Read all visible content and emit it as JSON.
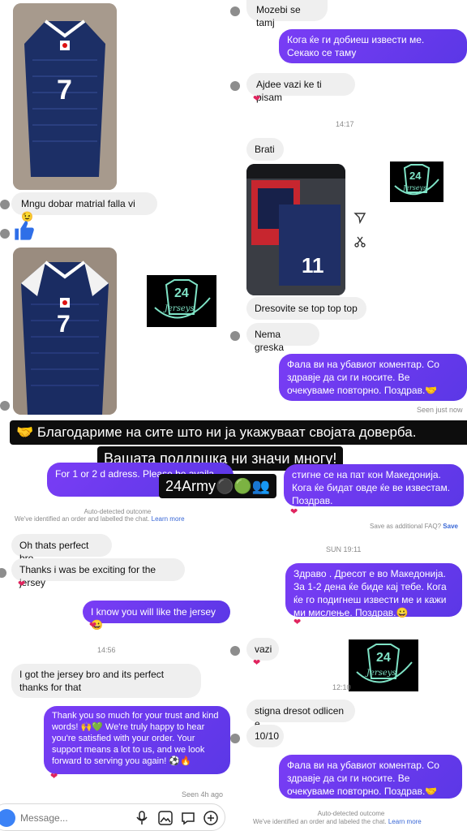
{
  "top_left": {
    "messages": [
      {
        "id": "m1",
        "text": "Mngu dobar matrial falla vi 😉"
      }
    ]
  },
  "top_right": {
    "messages": [
      {
        "id": "r1",
        "dir": "in",
        "text": "Mozebi se tamj"
      },
      {
        "id": "r2",
        "dir": "out",
        "text": "Кога ќе ги добиеш извести ме. Секако се таму"
      },
      {
        "id": "r3",
        "dir": "in",
        "text": "Ajdee vazi ke ti pisam"
      },
      {
        "id": "r4",
        "dir": "in",
        "text": "Brati"
      },
      {
        "id": "r5",
        "dir": "in",
        "text": "Dresovite se top top top"
      },
      {
        "id": "r6",
        "dir": "in",
        "text": "Nema greska"
      },
      {
        "id": "r7",
        "dir": "out",
        "text": "Фала ви на убавиот коментар. Со здравје да си ги носите. Ве очекуваме повторно. Поздрав.🤝"
      }
    ],
    "time": "14:17",
    "status": "Seen just now"
  },
  "banner": {
    "line1": "🤝 Благодариме на сите што ни ја укажуваат својата доверба.",
    "line2": "Вашата поддршка ни значи многу!",
    "line3": "24Army⚫🟢👥"
  },
  "bottom_left": {
    "partial_out": "For 1 or 2 d adress. Please be availa",
    "auto_detect_title": "Auto-detected outcome",
    "auto_detect_text": "We've identified an order and labelled the chat.",
    "learn_more": "Learn more",
    "messages": [
      {
        "id": "b1",
        "dir": "in",
        "text": "Oh thats perfect bro"
      },
      {
        "id": "b2",
        "dir": "in",
        "text": "Thanks i was be exciting for the jersey"
      },
      {
        "id": "b3",
        "dir": "out",
        "text": "I know you will like the jersey😀"
      },
      {
        "id": "b4",
        "dir": "in",
        "text": "I got the jersey bro and its perfect thanks for that"
      },
      {
        "id": "b5",
        "dir": "out",
        "text": "Thank you so much for your trust and kind words! 🙌💚 We're truly happy to hear you're satisfied with your order. Your support means a lot to us, and we look forward to serving you again! ⚽🔥"
      }
    ],
    "time": "14:56",
    "status": "Seen 4h ago",
    "composer_placeholder": "Message..."
  },
  "bottom_right": {
    "partial_out": "стигне се на пат кон Македонија. Кога ќе бидат овде ќе ве известам. Поздрав.",
    "faq_text": "Save as additional FAQ?",
    "faq_action": "Save",
    "day_time": "SUN 19:11",
    "messages": [
      {
        "id": "c1",
        "dir": "out",
        "text": "Здраво . Дресот е во Македонија. За 1-2 дена ќе биде кај тебе. Кога ќе го подигнеш извести ме и кажи ми мислење. Поздрав.😀"
      },
      {
        "id": "c2",
        "dir": "in",
        "text": "vazi"
      },
      {
        "id": "c3",
        "dir": "in",
        "text": "stigna dresot odlicen e"
      },
      {
        "id": "c4",
        "dir": "in",
        "text": "10/10"
      },
      {
        "id": "c5",
        "dir": "out",
        "text": "Фала ви на убавиот коментар. Со здравје да си ги носите. Ве очекуваме повторно. Поздрав.🤝"
      }
    ],
    "time": "12:10",
    "auto_detect_title": "Auto-detected outcome",
    "auto_detect_text": "We've identified an order and labeled the chat.",
    "learn_more": "Learn more"
  },
  "logo": {
    "number": "24",
    "word": "Jerseys"
  },
  "jersey_number": "7",
  "jersey_number_2": "11",
  "colors": {
    "accent": "#6a3cf0",
    "bubble_in": "#efefef",
    "heart": "#e0245e",
    "logo_green": "#7fe3c6"
  },
  "icons": [
    "thumbs-up-icon",
    "mic-icon",
    "image-icon",
    "sticker-icon",
    "plus-icon",
    "share-icon",
    "crop-icon"
  ]
}
